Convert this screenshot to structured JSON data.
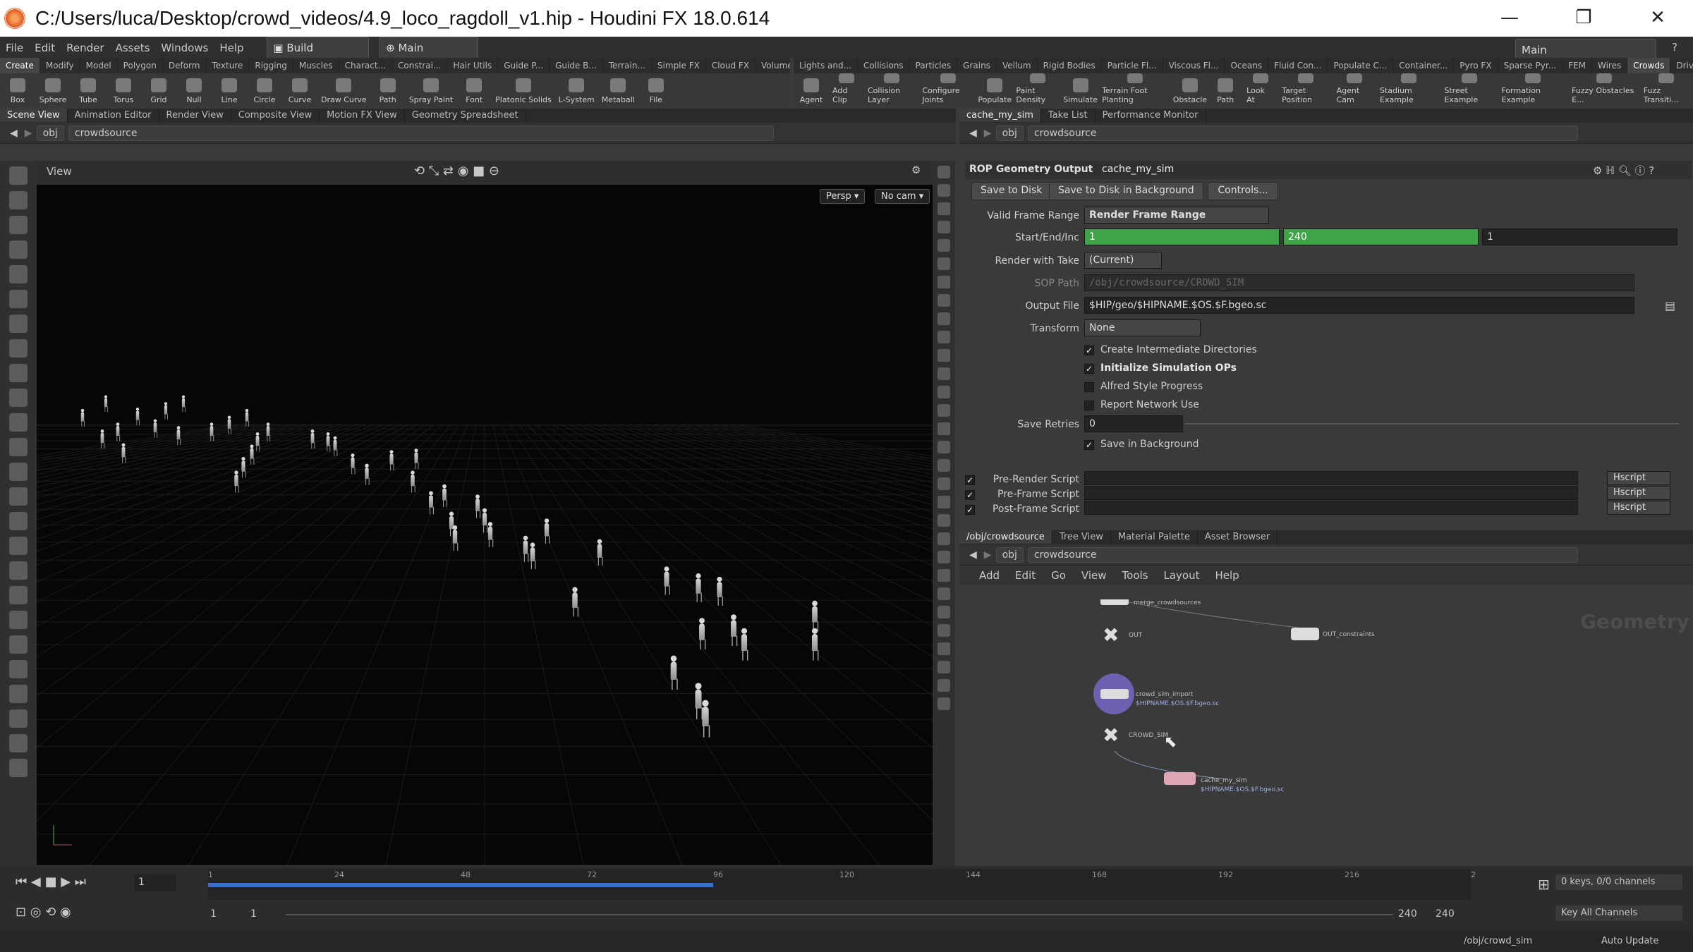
{
  "window": {
    "title": "C:/Users/luca/Desktop/crowd_videos/4.9_loco_ragdoll_v1.hip - Houdini FX 18.0.614"
  },
  "menu": [
    "File",
    "Edit",
    "Render",
    "Assets",
    "Windows",
    "Help"
  ],
  "desktop": "Build",
  "workspace": "Main",
  "workspace_right": "Main",
  "shelf_left": {
    "tabs": [
      "Create",
      "Modify",
      "Model",
      "Polygon",
      "Deform",
      "Texture",
      "Rigging",
      "Muscles",
      "Charact...",
      "Constrai...",
      "Hair Utils",
      "Guide P...",
      "Guide B...",
      "Terrain...",
      "Simple FX",
      "Cloud FX",
      "Volume"
    ],
    "tools": [
      "Box",
      "Sphere",
      "Tube",
      "Torus",
      "Grid",
      "Null",
      "Line",
      "Circle",
      "Curve",
      "Draw Curve",
      "Path",
      "Spray Paint",
      "Font",
      "Platonic Solids",
      "L-System",
      "Metaball",
      "File"
    ]
  },
  "shelf_right": {
    "tabs": [
      "Lights and...",
      "Collisions",
      "Particles",
      "Grains",
      "Vellum",
      "Rigid Bodies",
      "Particle Fl...",
      "Viscous Fl...",
      "Oceans",
      "Fluid Con...",
      "Populate C...",
      "Container...",
      "Pyro FX",
      "Sparse Pyr...",
      "FEM",
      "Wires",
      "Crowds",
      "Drive Sim..."
    ],
    "tools": [
      "Agent",
      "Add Clip",
      "Collision Layer",
      "Configure Joints",
      "Populate",
      "Paint Density",
      "Simulate",
      "Terrain Foot Planting",
      "Obstacle",
      "Path",
      "Look At",
      "Target Position",
      "Agent Cam",
      "Stadium Example",
      "Street Example",
      "Formation Example",
      "Fuzzy Obstacles E...",
      "Fuzz Transiti..."
    ]
  },
  "viewer": {
    "tabs": [
      "Scene View",
      "Animation Editor",
      "Render View",
      "Composite View",
      "Motion FX View",
      "Geometry Spreadsheet"
    ],
    "path": [
      "obj",
      "crowdsource"
    ],
    "label": "View",
    "persp": "Persp ▾",
    "cam": "No cam ▾"
  },
  "params": {
    "tabs": [
      "cache_my_sim",
      "Take List",
      "Performance Monitor"
    ],
    "path": [
      "obj",
      "crowdsource"
    ],
    "node_type": "ROP Geometry Output",
    "node_name": "cache_my_sim",
    "buttons": {
      "save": "Save to Disk",
      "save_bg": "Save to Disk in Background",
      "controls": "Controls..."
    },
    "valid_frame_range_label": "Valid Frame Range",
    "valid_frame_range": "Render Frame Range",
    "start_end_inc_label": "Start/End/Inc",
    "start": "1",
    "end": "240",
    "inc": "1",
    "render_with_take_label": "Render with Take",
    "render_with_take": "(Current)",
    "sop_path_label": "SOP Path",
    "sop_path": "/obj/crowdsource/CROWD_SIM",
    "output_file_label": "Output File",
    "output_file": "$HIP/geo/$HIPNAME.$OS.$F.bgeo.sc",
    "transform_label": "Transform",
    "transform": "None",
    "checks": [
      {
        "label": "Create Intermediate Directories",
        "checked": true
      },
      {
        "label": "Initialize Simulation OPs",
        "checked": true
      },
      {
        "label": "Alfred Style Progress",
        "checked": false
      },
      {
        "label": "Report Network Use",
        "checked": false
      }
    ],
    "save_retries_label": "Save Retries",
    "save_retries": "0",
    "save_in_bg": "Save in Background",
    "scripts": [
      {
        "label": "Pre-Render Script",
        "lang": "Hscript"
      },
      {
        "label": "Pre-Frame Script",
        "lang": "Hscript"
      },
      {
        "label": "Post-Frame Script",
        "lang": "Hscript"
      }
    ]
  },
  "network": {
    "tabs": [
      "/obj/crowdsource",
      "Tree View",
      "Material Palette",
      "Asset Browser"
    ],
    "path": [
      "obj",
      "crowdsource"
    ],
    "menu": [
      "Add",
      "Edit",
      "Go",
      "View",
      "Tools",
      "Layout",
      "Help"
    ],
    "context": "Geometry",
    "nodes": [
      {
        "name": "merge_crowdsources",
        "sub": ""
      },
      {
        "name": "OUT",
        "sub": ""
      },
      {
        "name": "OUT_constraints",
        "sub": ""
      },
      {
        "name": "crowd_sim_import",
        "sub": "$HIPNAME.$OS.$F.bgeo.sc"
      },
      {
        "name": "CROWD_SIM",
        "sub": ""
      },
      {
        "name": "cache_my_sim",
        "sub": "$HIPNAME.$OS.$F.bgeo.sc"
      }
    ]
  },
  "timeline": {
    "current_frame": "1",
    "ticks": [
      "1",
      "24",
      "48",
      "72",
      "96",
      "120",
      "144",
      "168",
      "192",
      "216",
      "2"
    ],
    "range_start": "1",
    "range_start2": "1",
    "range_end": "240",
    "range_end2": "240",
    "keys": "0 keys, 0/0 channels",
    "key_all": "Key All Channels",
    "path": "/obj/crowd_sim",
    "auto_update": "Auto Update",
    "progress": 0.4
  }
}
